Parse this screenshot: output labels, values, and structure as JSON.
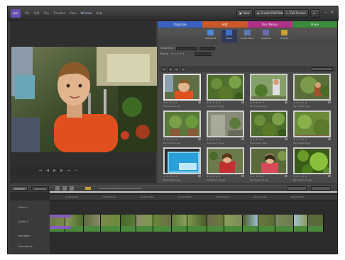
{
  "app": {
    "logo_text": "pre",
    "menu": [
      "File",
      "Edit",
      "Clip",
      "Timeline",
      "View",
      "Window",
      "Help"
    ],
    "menu_highlight_index": 5,
    "buttons": {
      "new": "New",
      "create_dvd": "Create DVD Menu",
      "full_screen": "Full Screen"
    }
  },
  "panel": {
    "tabs": [
      {
        "label": "Organize",
        "color": "#3a63c7"
      },
      {
        "label": "Edit",
        "color": "#d2592a"
      },
      {
        "label": "Disc Menus",
        "color": "#b52f8a"
      },
      {
        "label": "Share",
        "color": "#3a8f3a"
      }
    ],
    "tools": [
      {
        "label": "Get Media",
        "color": "#4a8ad6"
      },
      {
        "label": "Media",
        "color": "#3a6fd0",
        "active": true
      },
      {
        "label": "Smart Match",
        "color": "#5b7ab8"
      },
      {
        "label": "Organizer",
        "color": "#6b6bb0"
      },
      {
        "label": "Project",
        "color": "#c8a030"
      }
    ],
    "filters": {
      "show_label": "Show Only",
      "rating_label": "Rating"
    }
  },
  "media_items": [
    {
      "caption": "My Project 1.jpg",
      "scene": "boy"
    },
    {
      "caption": "My Project 2.jpg",
      "scene": "garden"
    },
    {
      "caption": "My Project 3.jpg",
      "scene": "plant"
    },
    {
      "caption": "My Project 4.jpg",
      "scene": "tree"
    },
    {
      "caption": "My Project 5.jpg",
      "scene": "pots"
    },
    {
      "caption": "My Project 6.jpg",
      "scene": "grey"
    },
    {
      "caption": "My Project 7.jpg",
      "scene": "garden"
    },
    {
      "caption": "My Project 8.jpg",
      "scene": "green"
    },
    {
      "caption": "My Project 9.jpg",
      "scene": "screen"
    },
    {
      "caption": "My Project 10.jpg",
      "scene": "girl"
    },
    {
      "caption": "My Project 11.jpg",
      "scene": "girl2"
    },
    {
      "caption": "My Project 12.jpg",
      "scene": "leaf"
    }
  ],
  "timeline": {
    "tabs": [
      "Timeline",
      "Sceneline"
    ],
    "ruler": [
      "00;00;00;00",
      "00;00;16;00",
      "00;00;32;00",
      "00;00;48;00",
      "00;01;04;00",
      "00;01;20;00",
      "00;01;36;00",
      "00;01;52;00"
    ],
    "tracks": [
      "Video 1",
      "Audio 1",
      "Narration",
      "Soundtrack"
    ]
  }
}
